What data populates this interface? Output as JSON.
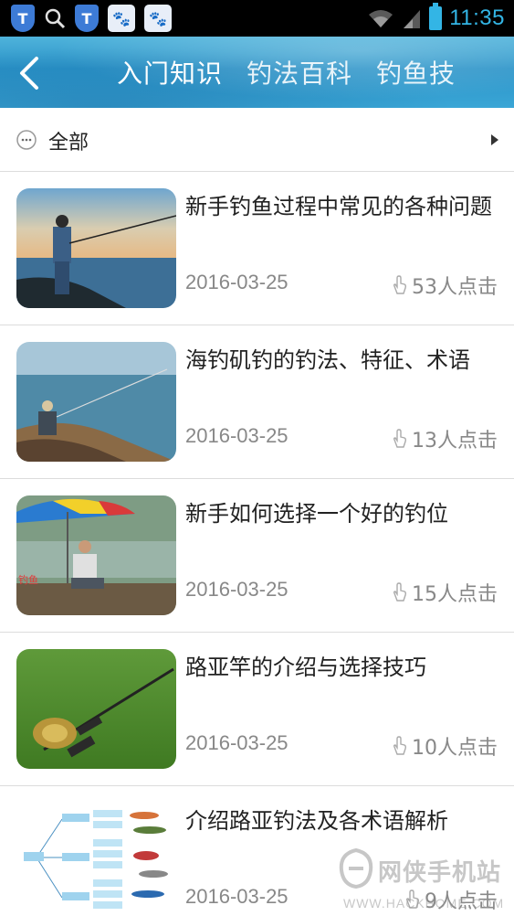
{
  "status_bar": {
    "time": "11:35",
    "left_icons": [
      "shield-icon",
      "search-icon",
      "shield-icon",
      "baidu-paw-icon",
      "baidu-paw-icon"
    ],
    "right_icons": [
      "wifi-icon",
      "signal-icon",
      "battery-icon"
    ]
  },
  "header": {
    "back_icon": "back-arrow-icon",
    "tabs": [
      {
        "label": "入门知识",
        "active": true
      },
      {
        "label": "钓法百科",
        "active": false
      },
      {
        "label": "钓鱼技",
        "active": false
      }
    ]
  },
  "filter": {
    "label": "全部",
    "icon": "more-circle-icon",
    "arrow": "chevron-right-icon"
  },
  "articles": [
    {
      "title": "新手钓鱼过程中常见的各种问题",
      "date": "2016-03-25",
      "clicks": "53人点击",
      "thumb": "fisherman-sea-photo"
    },
    {
      "title": "海钓矶钓的钓法、特征、术语",
      "date": "2016-03-25",
      "clicks": "13人点击",
      "thumb": "rock-fishing-photo"
    },
    {
      "title": "新手如何选择一个好的钓位",
      "date": "2016-03-25",
      "clicks": "15人点击",
      "thumb": "umbrella-fishing-photo"
    },
    {
      "title": "路亚竿的介绍与选择技巧",
      "date": "2016-03-25",
      "clicks": "10人点击",
      "thumb": "lure-rod-grass-photo"
    },
    {
      "title": "介绍路亚钓法及各术语解析",
      "date": "2016-03-25",
      "clicks": "9人点击",
      "thumb": "lure-mindmap-photo"
    }
  ],
  "watermark": {
    "text": "网侠手机站",
    "sub": "WWW.HACKHOME.COM"
  },
  "colors": {
    "header_blue": "#2a93c8",
    "status_accent": "#33b5e5",
    "meta_gray": "#888888"
  }
}
